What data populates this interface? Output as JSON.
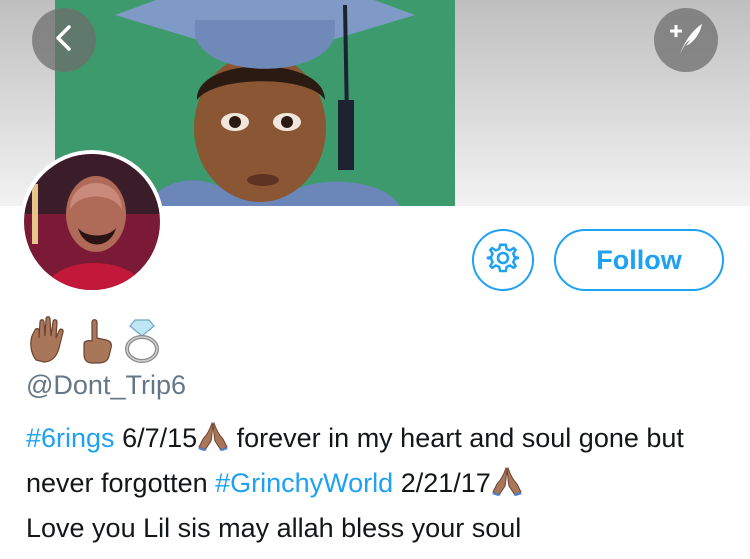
{
  "profile": {
    "handle": "@Dont_Trip6",
    "name_emojis": [
      "raised-hand-emoji",
      "pointing-up-emoji",
      "ring-emoji"
    ],
    "follow_label": "Follow",
    "bio": {
      "hashtag1": "#6rings",
      "text1": " 6/7/15",
      "text2": " forever in my heart and soul gone but never forgotten ",
      "hashtag2": "#GrinchyWorld",
      "text3": " 2/21/17",
      "text4": "Love you Lil sis may allah bless your soul"
    }
  },
  "colors": {
    "accent": "#1da1f2",
    "handle_gray": "#657786",
    "text": "#14171a"
  },
  "icons": {
    "back": "chevron-left-icon",
    "compose": "compose-feather-icon",
    "settings": "gear-icon",
    "bio_emoji": "folded-hands-emoji"
  }
}
